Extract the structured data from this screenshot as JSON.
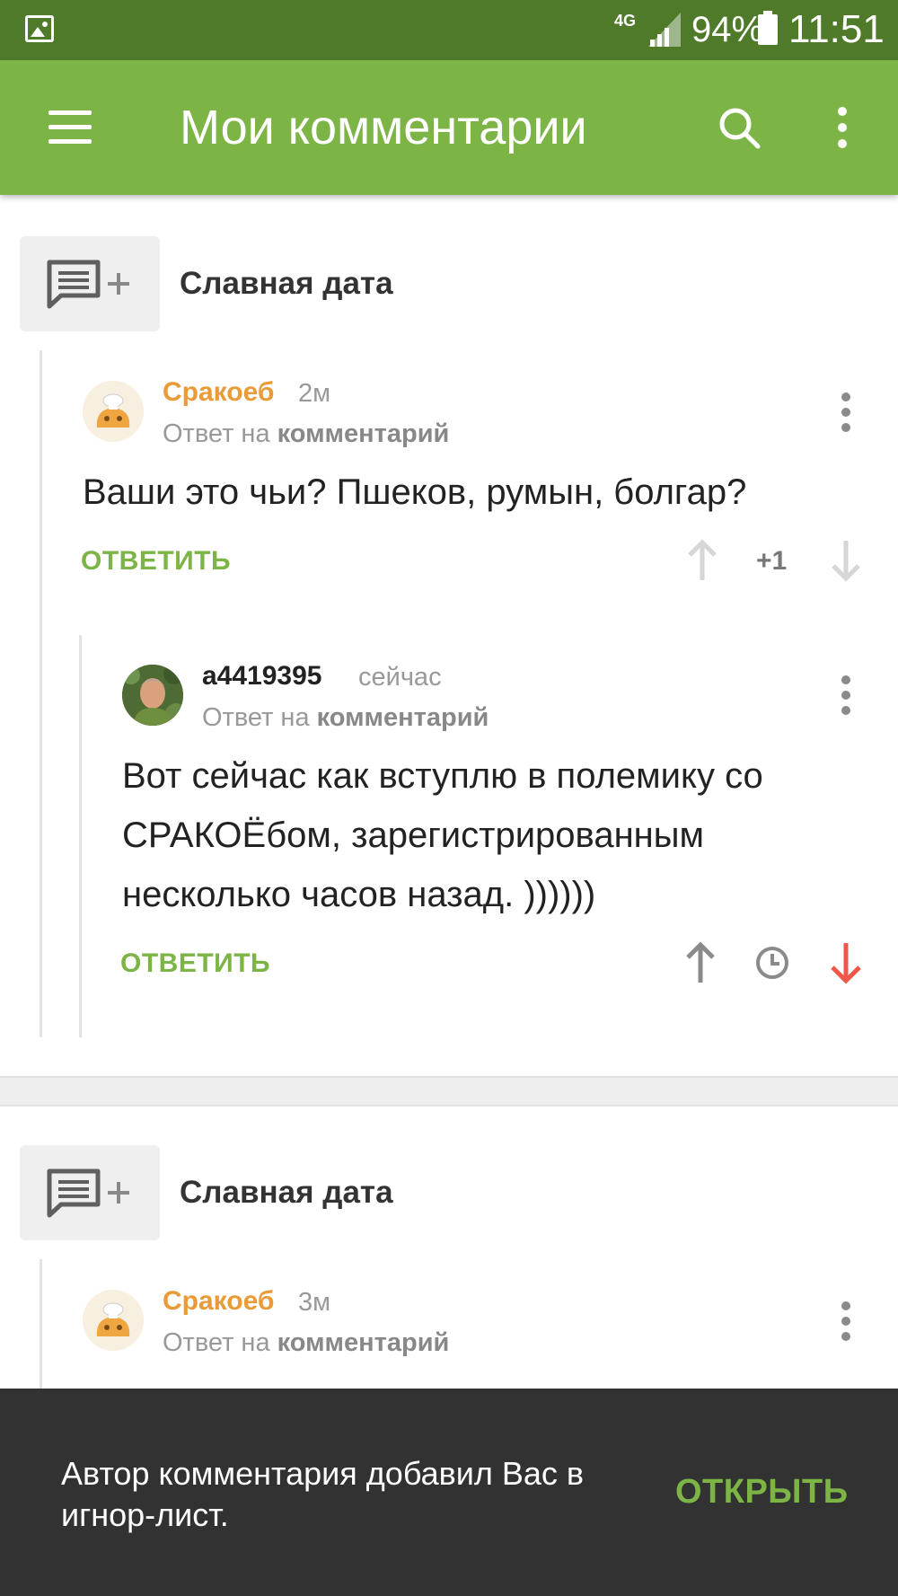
{
  "status_bar": {
    "network": "4G",
    "battery": "94%",
    "time": "11:51"
  },
  "app_bar": {
    "title": "Мои комментарии",
    "menu_icon": "hamburger-menu-icon",
    "search_icon": "search-icon",
    "more_icon": "more-vert-icon"
  },
  "posts": [
    {
      "title": "Славная дата",
      "comments": [
        {
          "author": "Сракоеб",
          "time": "2м",
          "reply_prefix": "Ответ на",
          "reply_target": "комментарий",
          "text": "Ваши это чьи? Пшеков, румын, болгар?",
          "reply_label": "ОТВЕТИТЬ",
          "score": "+1"
        },
        {
          "author": "a4419395",
          "time": "сейчас",
          "reply_prefix": "Ответ на",
          "reply_target": "комментарий",
          "text": "Вот сейчас как вступлю в полемику со СРАКОЁбом, зарегистрированным несколько часов назад. ))))))",
          "reply_label": "ОТВЕТИТЬ"
        }
      ]
    },
    {
      "title": "Славная дата",
      "comments": [
        {
          "author": "Сракоеб",
          "time": "3м",
          "reply_prefix": "Ответ на",
          "reply_target": "комментарий"
        }
      ]
    }
  ],
  "snackbar": {
    "message": "Автор комментария добавил Вас в игнор-лист.",
    "action": "ОТКРЫТЬ"
  },
  "colors": {
    "status_bar": "#4e7a2a",
    "app_bar": "#7cb446",
    "accent_green": "#7cb446",
    "author_orange": "#e89b37",
    "downvote_red": "#f0574a"
  }
}
